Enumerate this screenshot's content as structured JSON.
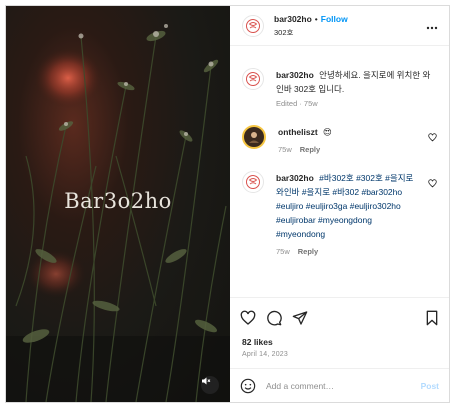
{
  "media": {
    "overlay_text": "Bar3o2ho"
  },
  "header": {
    "username": "bar302ho",
    "separator": "•",
    "follow_label": "Follow",
    "location": "302호",
    "more_icon": "more-horizontal-icon"
  },
  "caption": {
    "username": "bar302ho",
    "text": "안녕하세요. 을지로에 위치한 와인바 302호 입니다.",
    "meta": "Edited · 75w"
  },
  "comments": [
    {
      "username": "ontheliszt",
      "text": "😍",
      "time": "75w",
      "reply_label": "Reply"
    },
    {
      "username": "bar302ho",
      "hashtags": "#바302호 #302호 #을지로와인바 #을지로 #바302 #bar302ho #euljiro #euljiro3ga #euljiro302ho #euljirobar #myeongdong #myeondong",
      "time": "75w",
      "reply_label": "Reply"
    }
  ],
  "actions": {
    "icons": [
      "heart-icon",
      "comment-icon",
      "share-icon",
      "bookmark-icon"
    ]
  },
  "likes": "82 likes",
  "date": "April 14, 2023",
  "add_comment": {
    "placeholder": "Add a comment…",
    "post_label": "Post",
    "emoji_icon": "emoji-icon"
  },
  "colors": {
    "accent": "#0095f6",
    "hashtag": "#00376b",
    "muted": "#8e8e8e",
    "post_disabled": "#b3dbff",
    "brand_logo": "#d9534f"
  }
}
